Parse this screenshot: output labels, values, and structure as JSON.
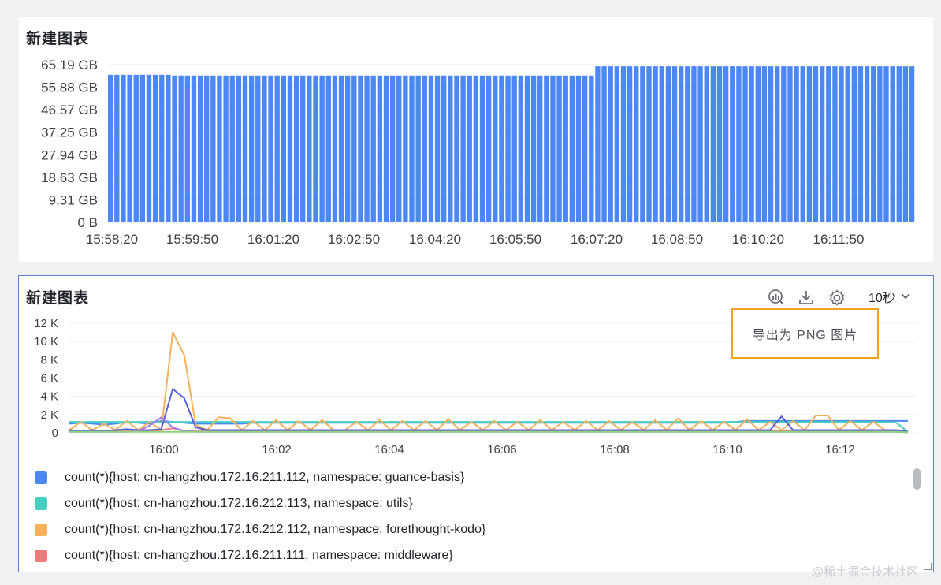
{
  "panel_top": {
    "title": "新建图表",
    "chart_data": {
      "type": "bar",
      "title": "新建图表",
      "y_ticks": [
        "65.19 GB",
        "55.88 GB",
        "46.57 GB",
        "37.25 GB",
        "27.94 GB",
        "18.63 GB",
        "9.31 GB",
        "0 B"
      ],
      "x_ticks": [
        "15:58:20",
        "15:59:50",
        "16:01:20",
        "16:02:50",
        "16:04:20",
        "16:05:50",
        "16:07:20",
        "16:08:50",
        "16:10:20",
        "16:11:50"
      ],
      "ylim": [
        0,
        65.19
      ],
      "unit": "GB",
      "bar_color": "#4b87f5",
      "values": [
        61.0,
        61.0,
        61.0,
        61.0,
        61.0,
        61.0,
        61.0,
        61.0,
        61.0,
        61.0,
        60.7,
        60.7,
        60.7,
        60.7,
        60.7,
        60.7,
        60.7,
        60.7,
        60.7,
        60.7,
        60.7,
        60.7,
        60.7,
        60.7,
        60.7,
        60.7,
        60.7,
        60.7,
        60.7,
        60.7,
        60.7,
        60.7,
        60.7,
        60.7,
        60.7,
        60.7,
        60.7,
        60.7,
        60.7,
        60.7,
        60.7,
        60.7,
        60.7,
        60.7,
        60.7,
        60.7,
        60.7,
        60.7,
        60.7,
        60.7,
        60.7,
        60.7,
        60.7,
        60.7,
        60.7,
        60.7,
        60.7,
        60.7,
        60.7,
        60.7,
        60.7,
        60.7,
        60.7,
        60.7,
        60.7,
        60.7,
        60.7,
        60.7,
        60.7,
        60.7,
        60.7,
        60.7,
        60.7,
        60.7,
        60.7,
        60.7,
        64.5,
        64.5,
        64.5,
        64.5,
        64.5,
        64.5,
        64.5,
        64.5,
        64.5,
        64.5,
        64.5,
        64.5,
        64.5,
        64.5,
        64.5,
        64.5,
        64.5,
        64.5,
        64.5,
        64.5,
        64.5,
        64.5,
        64.5,
        64.5,
        64.5,
        64.5,
        64.5,
        64.5,
        64.5,
        64.5,
        64.5,
        64.5,
        64.5,
        64.5,
        64.5,
        64.5,
        64.5,
        64.5,
        64.5,
        64.5,
        64.5,
        64.5,
        64.5,
        64.5,
        64.5,
        64.5,
        64.5,
        64.5,
        64.5,
        64.5
      ]
    }
  },
  "panel_bottom": {
    "title": "新建图表",
    "toolbar": {
      "icons": [
        "query-icon",
        "download-icon",
        "settings-icon"
      ],
      "interval": "10秒"
    },
    "tooltip": "导出为 PNG 图片",
    "chart_data": {
      "type": "line",
      "y_ticks": [
        "12 K",
        "10 K",
        "8 K",
        "6 K",
        "4 K",
        "2 K",
        "0"
      ],
      "x_ticks": [
        "16:00",
        "16:02",
        "16:04",
        "16:06",
        "16:08",
        "16:10",
        "16:12"
      ],
      "ylim": [
        0,
        12000
      ],
      "series": [
        {
          "color": "#4b87f5",
          "values": [
            1000,
            1100,
            1000,
            900,
            1000,
            1200,
            1100,
            1000,
            1300,
            1200,
            1100,
            1000,
            1000,
            1000,
            1000,
            1000,
            1100,
            1100,
            1100,
            1100,
            1100,
            1100,
            1100,
            1100,
            1100,
            1100,
            1100,
            1100,
            1100,
            1100,
            1100,
            1100,
            1100,
            1100,
            1100,
            1100,
            1100,
            1100,
            1100,
            1100,
            1100,
            1100,
            1100,
            1100,
            1100,
            1100,
            1100,
            1100,
            1100,
            1100,
            1100,
            1100,
            1100,
            1100,
            1100,
            1100,
            1100,
            1100,
            1200,
            1300,
            1300,
            1300,
            1300,
            1300,
            1300,
            1300,
            1300,
            1300,
            1300,
            1300,
            1300,
            1300,
            1300,
            1300
          ]
        },
        {
          "color": "#45cfc3",
          "values": [
            1200,
            1200,
            1200,
            1200,
            1200,
            1200,
            1200,
            1200,
            1200,
            1200,
            1200,
            1200,
            1200,
            1200,
            1200,
            1200,
            1200,
            1200,
            1200,
            1200,
            1200,
            1200,
            1200,
            1200,
            1200,
            1200,
            1200,
            1200,
            1200,
            1200,
            1200,
            1200,
            1200,
            1200,
            1200,
            1200,
            1200,
            1200,
            1200,
            1200,
            1200,
            1200,
            1200,
            1200,
            1200,
            1200,
            1200,
            1200,
            1200,
            1200,
            1200,
            1200,
            1200,
            1200,
            1200,
            1200,
            1200,
            1200,
            1200,
            1200,
            1200,
            1200,
            1200,
            1200,
            1200,
            1200,
            1200,
            1200,
            1200,
            1200,
            1200,
            1200,
            1100,
            100
          ]
        },
        {
          "color": "#f7b15a",
          "values": [
            300,
            1200,
            300,
            1000,
            300,
            1300,
            300,
            1200,
            300,
            11000,
            8500,
            900,
            300,
            1700,
            1600,
            300,
            1300,
            300,
            1400,
            300,
            1300,
            300,
            1400,
            300,
            300,
            1200,
            300,
            1400,
            300,
            1300,
            300,
            1300,
            300,
            1500,
            300,
            1200,
            300,
            1300,
            300,
            1200,
            300,
            1400,
            300,
            1200,
            300,
            1300,
            300,
            1300,
            300,
            1200,
            300,
            1400,
            300,
            1600,
            300,
            1300,
            300,
            1200,
            300,
            1500,
            300,
            1200,
            300,
            1300,
            300,
            1900,
            1900,
            300,
            1300,
            300,
            1200,
            300,
            300,
            100
          ]
        },
        {
          "color": "#f07a7a",
          "values": [
            200,
            200,
            200,
            200,
            200,
            200,
            200,
            200,
            300,
            500,
            200,
            200,
            200,
            200,
            200,
            200,
            200,
            200,
            200,
            200,
            200,
            200,
            200,
            200,
            200,
            200,
            200,
            200,
            200,
            200,
            200,
            200,
            200,
            200,
            200,
            200,
            200,
            200,
            200,
            200,
            200,
            200,
            200,
            200,
            200,
            200,
            200,
            200,
            200,
            200,
            200,
            200,
            200,
            200,
            200,
            200,
            200,
            200,
            200,
            200,
            200,
            200,
            200,
            200,
            200,
            200,
            200,
            200,
            200,
            200,
            200,
            200,
            200,
            100
          ]
        },
        {
          "color": "#5a5fd6",
          "values": [
            300,
            200,
            300,
            200,
            300,
            400,
            300,
            300,
            400,
            4800,
            3800,
            600,
            300,
            300,
            300,
            300,
            300,
            300,
            300,
            300,
            300,
            300,
            300,
            300,
            300,
            300,
            300,
            300,
            300,
            300,
            300,
            300,
            300,
            300,
            300,
            300,
            300,
            300,
            300,
            300,
            300,
            300,
            300,
            300,
            300,
            300,
            300,
            300,
            300,
            300,
            300,
            300,
            300,
            300,
            300,
            300,
            300,
            300,
            300,
            300,
            300,
            300,
            1800,
            300,
            300,
            300,
            300,
            300,
            300,
            300,
            300,
            300,
            300,
            100
          ]
        },
        {
          "color": "#a77bf0",
          "values": [
            100,
            100,
            100,
            100,
            100,
            100,
            200,
            800,
            1700,
            600,
            200,
            100,
            100,
            100,
            100,
            100,
            100,
            100,
            100,
            100,
            100,
            100,
            100,
            100,
            100,
            100,
            100,
            100,
            100,
            100,
            100,
            100,
            100,
            100,
            100,
            100,
            100,
            100,
            100,
            100,
            100,
            100,
            100,
            100,
            100,
            100,
            100,
            100,
            100,
            100,
            100,
            100,
            100,
            100,
            100,
            100,
            100,
            100,
            100,
            100,
            100,
            100,
            100,
            100,
            100,
            100,
            100,
            100,
            100,
            100,
            100,
            100,
            100,
            50
          ]
        },
        {
          "color": "#8bd67a",
          "values": [
            100,
            100,
            100,
            100,
            100,
            100,
            100,
            100,
            100,
            100,
            100,
            100,
            100,
            100,
            100,
            100,
            100,
            100,
            100,
            100,
            100,
            100,
            100,
            100,
            100,
            100,
            100,
            100,
            100,
            100,
            100,
            100,
            100,
            100,
            100,
            100,
            100,
            100,
            100,
            100,
            100,
            100,
            100,
            100,
            100,
            100,
            100,
            100,
            100,
            100,
            100,
            100,
            100,
            100,
            100,
            100,
            100,
            100,
            100,
            100,
            100,
            100,
            100,
            100,
            100,
            100,
            100,
            100,
            100,
            100,
            100,
            100,
            100,
            50
          ]
        }
      ]
    },
    "legend": [
      {
        "label": "count(*){host: cn-hangzhou.172.16.211.112, namespace: guance-basis}",
        "color": "#4b87f5"
      },
      {
        "label": "count(*){host: cn-hangzhou.172.16.212.113, namespace: utils}",
        "color": "#45cfc3"
      },
      {
        "label": "count(*){host: cn-hangzhou.172.16.212.112, namespace: forethought-kodo}",
        "color": "#f7b15a"
      },
      {
        "label": "count(*){host: cn-hangzhou.172.16.211.111, namespace: middleware}",
        "color": "#f07a7a"
      }
    ]
  },
  "watermark": "@稀土掘金技术社区"
}
